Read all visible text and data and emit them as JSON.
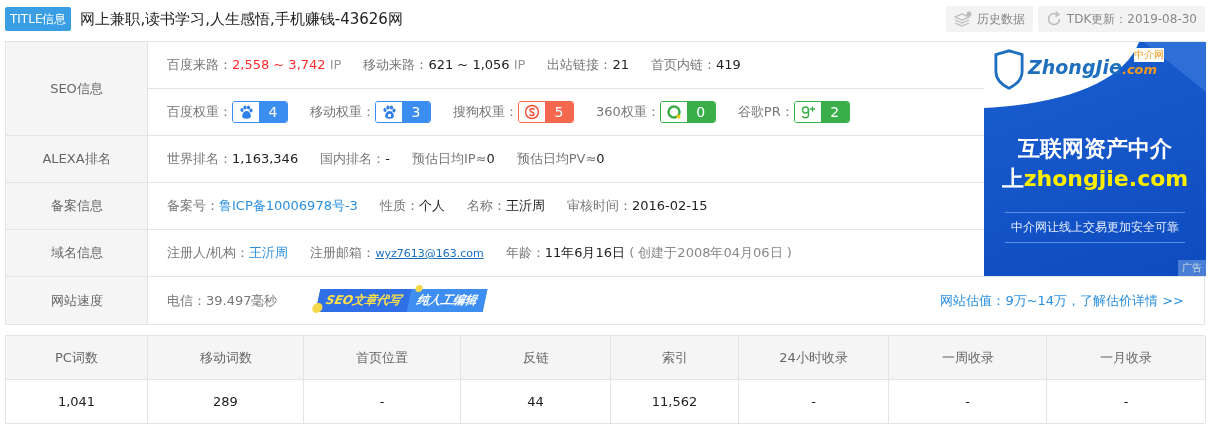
{
  "title": {
    "badge": "TITLE信息",
    "text": "网上兼职,读书学习,人生感悟,手机赚钱-43626网"
  },
  "actions": [
    {
      "kind": "history",
      "label": "历史数据"
    },
    {
      "kind": "refresh",
      "label": "TDK更新：2019-08-30"
    }
  ],
  "sections": [
    {
      "label": "SEO信息",
      "lines": [
        [
          {
            "kind": "pair",
            "label": "百度来路：",
            "value": "2,558 ~ 3,742",
            "color": "#ff2a2a",
            "unit": "IP"
          },
          {
            "kind": "pair",
            "label": "移动来路：",
            "value": "621 ~ 1,056",
            "color": "#222222",
            "unit": "IP"
          },
          {
            "kind": "pair",
            "label": "出站链接：",
            "value": "21",
            "color": "#222222"
          },
          {
            "kind": "pair",
            "label": "首页内链：",
            "value": "419",
            "color": "#222222"
          }
        ],
        [
          {
            "kind": "badge",
            "label": "百度权重：",
            "value": "4",
            "color": "#3b8df0"
          },
          {
            "kind": "badge",
            "label": "移动权重：",
            "value": "3",
            "color": "#3b8df0"
          },
          {
            "kind": "badge",
            "label": "搜狗权重：",
            "value": "5",
            "color": "#f5674e"
          },
          {
            "kind": "badge",
            "label": "360权重：",
            "value": "0",
            "color": "#3aae49"
          },
          {
            "kind": "badge",
            "label": "谷歌PR：",
            "value": "2",
            "color": "#3aae49"
          }
        ]
      ]
    },
    {
      "label": "ALEXA排名",
      "lines": [
        [
          {
            "kind": "pair",
            "label": "世界排名：",
            "value": "1,163,346",
            "color": "#222222"
          },
          {
            "kind": "pair",
            "label": "国内排名：",
            "value": "-",
            "color": "#222222"
          },
          {
            "kind": "pair",
            "label": "预估日均IP≈",
            "value": "0",
            "color": "#222222"
          },
          {
            "kind": "pair",
            "label": "预估日均PV≈",
            "value": "0",
            "color": "#222222"
          }
        ]
      ]
    },
    {
      "label": "备案信息",
      "lines": [
        [
          {
            "kind": "link",
            "label": "备案号：",
            "value": "鲁ICP备10006978号-3",
            "color": "#2a8fe0"
          },
          {
            "kind": "pair",
            "label": "性质：",
            "value": "个人",
            "color": "#222222"
          },
          {
            "kind": "pair",
            "label": "名称：",
            "value": "王沂周",
            "color": "#222222"
          },
          {
            "kind": "pair",
            "label": "审核时间：",
            "value": "2016-02-15",
            "color": "#222222"
          }
        ]
      ]
    },
    {
      "label": "域名信息",
      "lines": [
        [
          {
            "kind": "link",
            "label": "注册人/机构：",
            "value": "王沂周",
            "color": "#2a8fe0"
          },
          {
            "kind": "email",
            "label": "注册邮箱：",
            "value": "wyz7613@163.com",
            "color": "#1a6fc0"
          },
          {
            "kind": "pair",
            "label": "年龄：",
            "value": "11年6月16日",
            "color": "#222222",
            "note": "( 创建于2008年04月06日 )"
          }
        ]
      ]
    }
  ],
  "speed": {
    "label": "网站速度",
    "reading": "电信：39.497毫秒",
    "promo": [
      "SEO文章代写",
      "纯人工编辑"
    ],
    "valuation": "网站估值：9万~14万，了解估价详情 >>"
  },
  "ad": {
    "logo": "ZhongJie",
    "logo_domain": ".com",
    "logo_mark": "中介网",
    "headline": "互联网资产中介",
    "line_prefix": "上",
    "line_domain": "zhongjie.com",
    "tagline": "中介网让线上交易更加安全可靠",
    "tag": "广告"
  },
  "stats": {
    "columns": [
      "PC词数",
      "移动词数",
      "首页位置",
      "反链",
      "索引",
      "24小时收录",
      "一周收录",
      "一月收录"
    ],
    "values": [
      "1,041",
      "289",
      "-",
      "44",
      "11,562",
      "-",
      "-",
      "-"
    ]
  }
}
